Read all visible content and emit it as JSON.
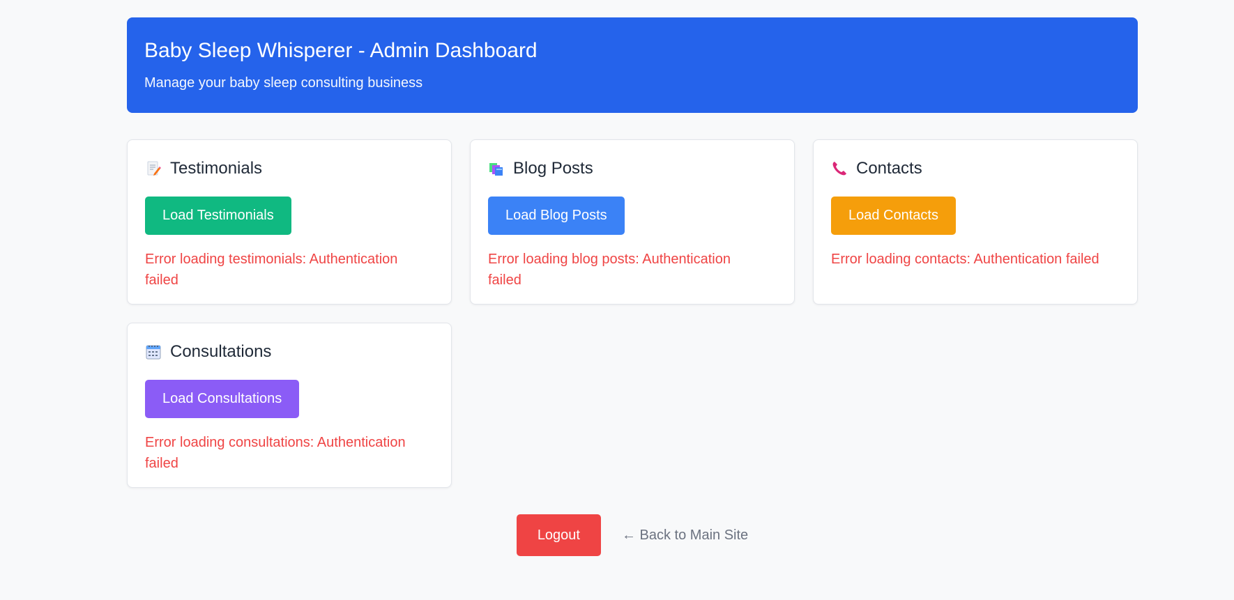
{
  "header": {
    "title": "Baby Sleep Whisperer - Admin Dashboard",
    "subtitle": "Manage your baby sleep consulting business"
  },
  "cards": [
    {
      "icon": "memo-icon",
      "title": "Testimonials",
      "button_label": "Load Testimonials",
      "button_color": "#10b981",
      "error": "Error loading testimonials: Authentication failed"
    },
    {
      "icon": "books-icon",
      "title": "Blog Posts",
      "button_label": "Load Blog Posts",
      "button_color": "#3b82f6",
      "error": "Error loading blog posts: Authentication failed"
    },
    {
      "icon": "phone-icon",
      "title": "Contacts",
      "button_label": "Load Contacts",
      "button_color": "#f59e0b",
      "error": "Error loading contacts: Authentication failed"
    },
    {
      "icon": "calendar-icon",
      "title": "Consultations",
      "button_label": "Load Consultations",
      "button_color": "#8b5cf6",
      "error": "Error loading consultations: Authentication failed"
    }
  ],
  "footer": {
    "logout_label": "Logout",
    "back_label": "← Back to Main Site"
  },
  "colors": {
    "header_bg": "#2563eb",
    "error": "#ef4444",
    "logout": "#ef4444",
    "page_bg": "#f8f9fa"
  }
}
